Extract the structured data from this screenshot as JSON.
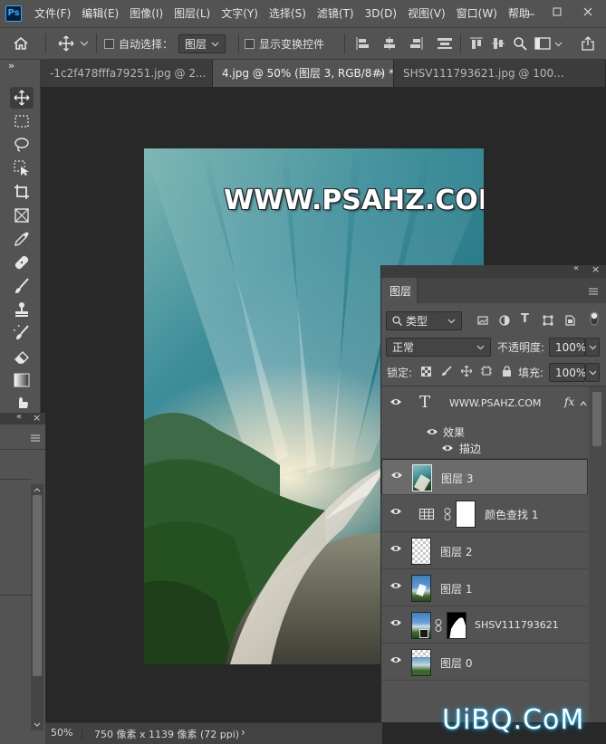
{
  "menubar": {
    "logo": "Ps",
    "items": [
      "文件(F)",
      "编辑(E)",
      "图像(I)",
      "图层(L)",
      "文字(Y)",
      "选择(S)",
      "滤镜(T)",
      "3D(D)",
      "视图(V)",
      "窗口(W)",
      "帮助"
    ]
  },
  "options": {
    "auto_select_label": "自动选择：",
    "auto_select_value": "图层",
    "show_transform_label": "显示变换控件"
  },
  "tabs": [
    {
      "label": "-1c2f478fffa79251.jpg @ 2..."
    },
    {
      "label": "4.jpg @ 50% (图层 3, RGB/8#) *",
      "close": "×"
    },
    {
      "label": "SHSV111793621.jpg @ 100..."
    }
  ],
  "toolbar": {
    "collapse": "»",
    "tools": [
      "move-tool",
      "marquee-tool",
      "lasso-tool",
      "object-select-tool",
      "crop-tool",
      "frame-tool",
      "eyedropper-tool",
      "healing-tool",
      "brush-tool",
      "stamp-tool",
      "history-brush-tool",
      "eraser-tool",
      "gradient-tool",
      "smudge-tool"
    ]
  },
  "canvas": {
    "watermark": "WWW.PSAHZ.COM"
  },
  "status": {
    "zoom": "50%",
    "doc_info": "750 像素 x 1139 像素 (72 ppi)",
    "arrow": "›"
  },
  "layers_panel": {
    "collapse": "«",
    "close": "×",
    "title": "图层",
    "filter_kind": "类型",
    "blend_mode": "正常",
    "opacity_label": "不透明度:",
    "opacity_value": "100%",
    "lock_label": "锁定:",
    "fill_label": "填充:",
    "fill_value": "100%",
    "layers": [
      {
        "name": "WWW.PSAHZ.COM",
        "type": "text",
        "fx": "fx"
      },
      {
        "name": "图层 3",
        "type": "image",
        "selected": true
      },
      {
        "name": "颜色查找 1",
        "type": "adjustment"
      },
      {
        "name": "图层 2",
        "type": "transparent"
      },
      {
        "name": "图层 1",
        "type": "image"
      },
      {
        "name": "SHSV111793621",
        "type": "masked"
      },
      {
        "name": "图层 0",
        "type": "image"
      }
    ],
    "effects_label": "效果",
    "stroke_label": "描边"
  },
  "left_panel": {
    "collapse": "«",
    "close": "×"
  },
  "site_watermark": "UiBQ.CoM",
  "colors": {
    "ui": "#535353",
    "canvas_bg": "#282828",
    "accent": "#31a8ff",
    "selected_layer": "#6b6b6b"
  }
}
